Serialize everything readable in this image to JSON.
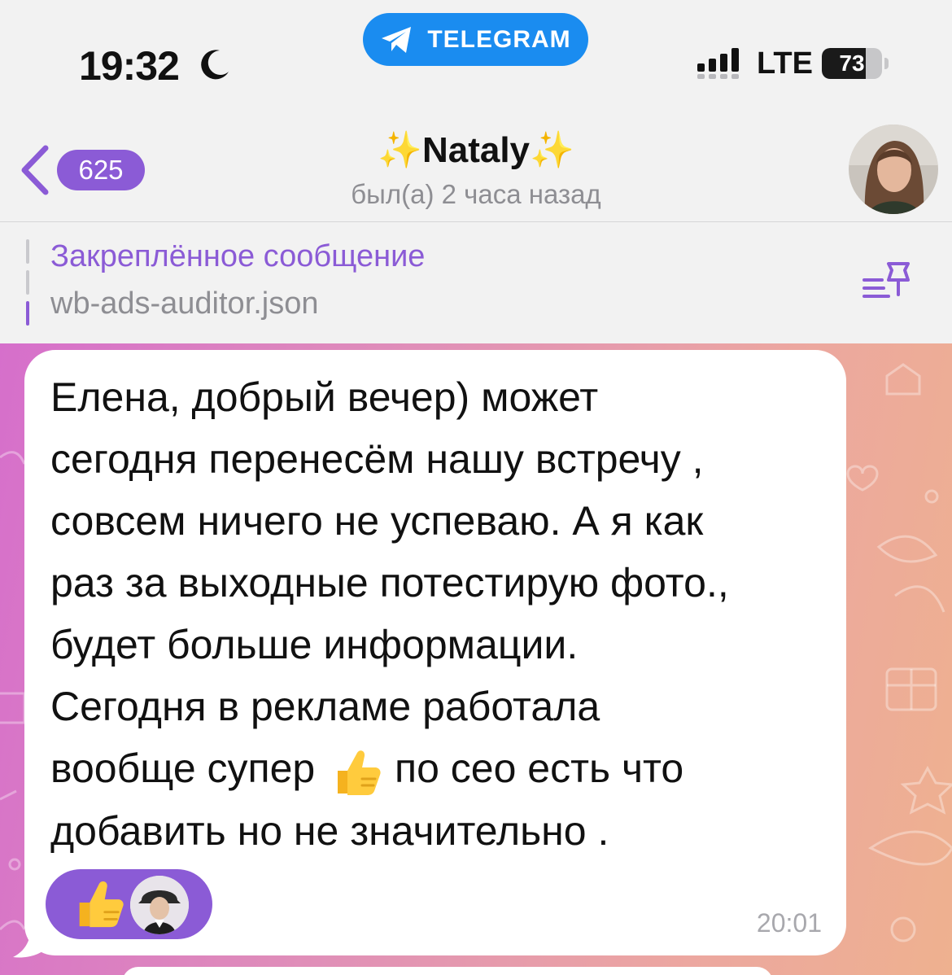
{
  "status_bar": {
    "time": "19:32",
    "banner_label": "TELEGRAM",
    "network": "LTE",
    "battery": "73",
    "battery_fraction": 0.73,
    "icons": [
      "moon-icon",
      "telegram-icon",
      "signal-icon",
      "battery-icon"
    ]
  },
  "header": {
    "unread_count": "625",
    "title": "✨Nataly✨",
    "subtitle": "был(а) 2 часа назад"
  },
  "pinned": {
    "title": "Закреплённое сообщение",
    "file": "wb-ads-auditor.json"
  },
  "message": {
    "text_before_emoji": "Елена, добрый вечер) может\nсегодня перенесём нашу встречу ,\nсовсем ничего не успеваю. А я как\nраз за выходные потестирую фото.,\nбудет больше информации.\nСегодня в рекламе работала\nвообще супер ",
    "emoji": "thumbs-up-icon",
    "text_after_emoji": " по сео есть что\nдобавить но не значительно .",
    "time": "20:01",
    "reaction": "thumbs-up-icon"
  },
  "colors": {
    "accent": "#8b5bd6",
    "telegram_blue": "#1a8cf0",
    "header_bg": "#f2f2f2",
    "secondary_text": "#8e8e93"
  }
}
